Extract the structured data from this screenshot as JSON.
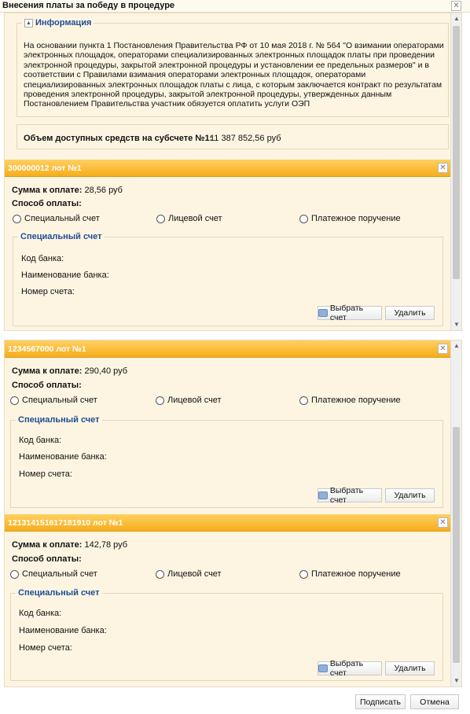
{
  "window": {
    "title": "Внесения платы за победу в процедуре"
  },
  "info": {
    "legend": "Информация",
    "text": "На основании пункта 1 Постановления Правительства РФ от 10 мая 2018 г. № 564 \"О взимании операторами электронных площадок, операторами специализированных электронных площадок платы при проведении электронной процедуры, закрытой электронной процедуры и установлении ее предельных размеров\" и в соответствии с Правилами взимания операторами электронных площадок, операторами специализированных электронных площадок платы с лица, с которым заключается контракт по результатам проведения электронной процедуры, закрытой электронной процедуры, утвержденных данным Постановлением Правительства участник обязуется оплатить услуги ОЭП"
  },
  "balance": {
    "label": "Объем доступных средств на субсчете №1:",
    "value": "11 387 852,56 руб"
  },
  "lot_labels": {
    "amount": "Сумма к оплате:",
    "method": "Способ оплаты:",
    "opt_special": "Специальный счет",
    "opt_personal": "Лицевой счет",
    "opt_order": "Платежное поручение",
    "account_legend": "Специальный счет",
    "bank_code": "Код банка:",
    "bank_name": "Наименование банка:",
    "account_number": "Номер счета:",
    "choose_btn": "Выбрать счет",
    "delete_btn": "Удалить"
  },
  "lots": [
    {
      "title": "300000012 лот №1",
      "amount": "28,56 руб"
    },
    {
      "title": "1234567000 лот №1",
      "amount": "290,40 руб"
    },
    {
      "title": "121314151617181910 лот №1",
      "amount": "142,78 руб"
    }
  ],
  "footer": {
    "sign_btn": "Подписать",
    "cancel_btn": "Отмена"
  },
  "colors": {
    "accent": "#f6ad1b",
    "legend": "#1f4e94",
    "panel": "#fdf5e2"
  }
}
